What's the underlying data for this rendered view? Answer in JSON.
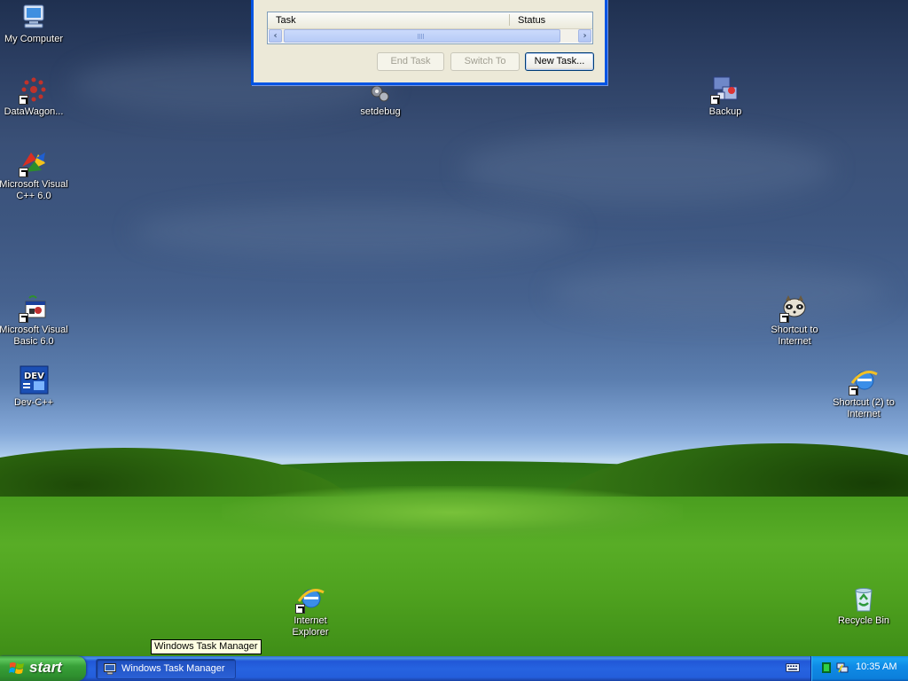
{
  "desktop": {
    "icons": [
      {
        "label": "My Computer",
        "icon": "my-computer-icon"
      },
      {
        "label": "DataWagon...",
        "icon": "datawagon-icon"
      },
      {
        "label": "Microsoft Visual C++ 6.0",
        "icon": "visual-cpp-icon"
      },
      {
        "label": "Microsoft Visual Basic 6.0",
        "icon": "visual-basic-icon"
      },
      {
        "label": "Dev-C++",
        "icon": "dev-cpp-icon"
      },
      {
        "label": "setdebug",
        "icon": "setdebug-icon"
      },
      {
        "label": "Backup",
        "icon": "backup-icon"
      },
      {
        "label": "Shortcut to Internet",
        "icon": "raccoon-icon"
      },
      {
        "label": "Shortcut (2) to Internet",
        "icon": "internet-explorer-icon"
      },
      {
        "label": "Internet Explorer",
        "icon": "internet-explorer-icon"
      },
      {
        "label": "Recycle Bin",
        "icon": "recycle-bin-icon"
      }
    ]
  },
  "task_manager": {
    "columns": [
      "Task",
      "Status"
    ],
    "buttons": {
      "end_task": "End Task",
      "switch_to": "Switch To",
      "new_task": "New Task..."
    }
  },
  "tooltip": {
    "text": "Windows Task Manager"
  },
  "taskbar": {
    "start_label": "start",
    "task_button_label": "Windows Task Manager",
    "clock": "10:35 AM"
  },
  "colors": {
    "taskbar_blue": "#245edb",
    "start_green": "#38a038",
    "tray_blue": "#0f8be6",
    "tooltip_bg": "#ffffe1"
  }
}
